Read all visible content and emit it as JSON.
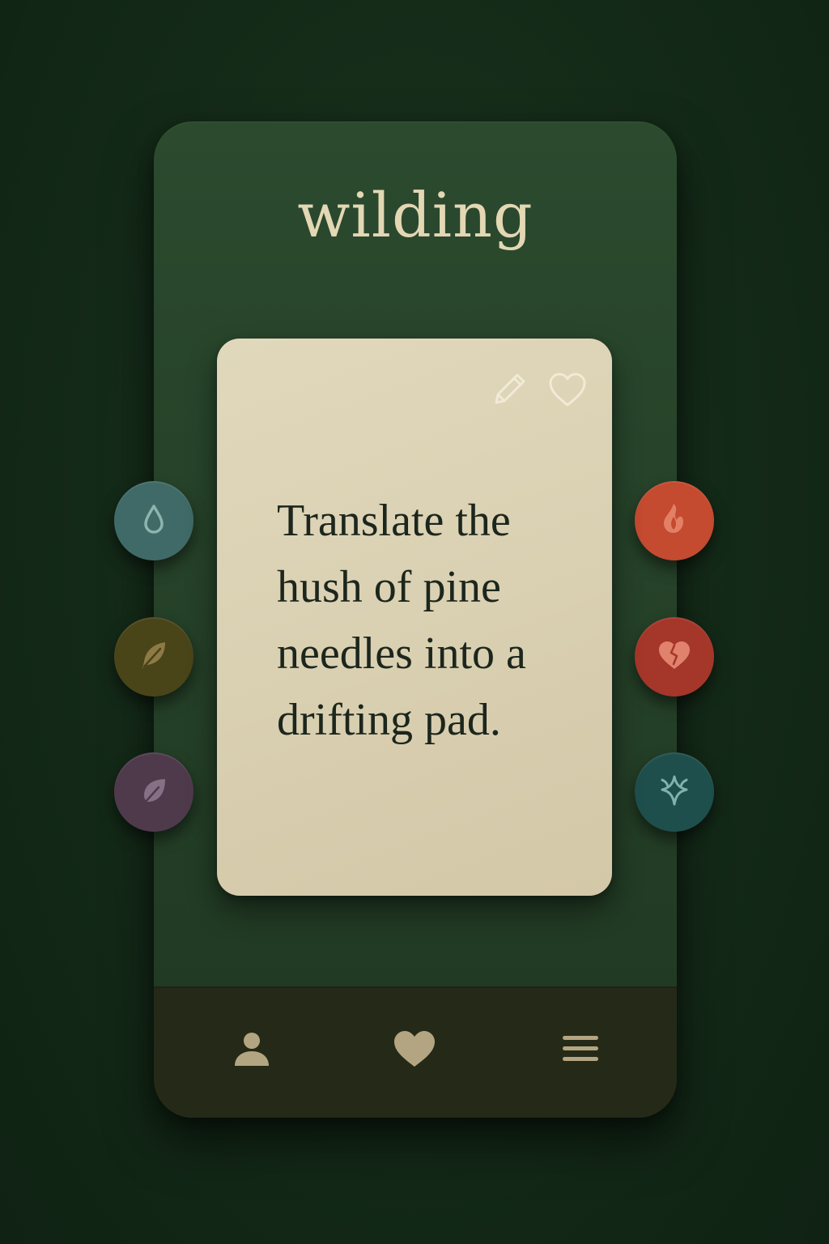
{
  "app": {
    "title": "wilding"
  },
  "card": {
    "prompt": "Translate the\nhush of pine\nneedles into a\ndrifting pad.",
    "actions": [
      {
        "icon": "pencil-icon"
      },
      {
        "icon": "heart-outline-icon"
      }
    ]
  },
  "tokens": {
    "left": [
      {
        "icon": "water-drop-icon",
        "color": "#3f6a67"
      },
      {
        "icon": "feather-icon",
        "color": "#4a4419"
      },
      {
        "icon": "leaf-icon",
        "color": "#4f3a4c"
      }
    ],
    "right": [
      {
        "icon": "flame-icon",
        "color": "#c44a30"
      },
      {
        "icon": "broken-heart-icon",
        "color": "#a5362a"
      },
      {
        "icon": "sparkle-icon",
        "color": "#1f4f4c"
      }
    ]
  },
  "nav": {
    "items": [
      {
        "icon": "profile-icon"
      },
      {
        "icon": "heart-icon"
      },
      {
        "icon": "menu-icon"
      }
    ]
  },
  "colors": {
    "background": "#142a18",
    "phone": "#243f27",
    "card": "#d9cfb1",
    "title": "#e3d7b4",
    "nav": "#242a17",
    "nav_icon": "#b4a582"
  }
}
